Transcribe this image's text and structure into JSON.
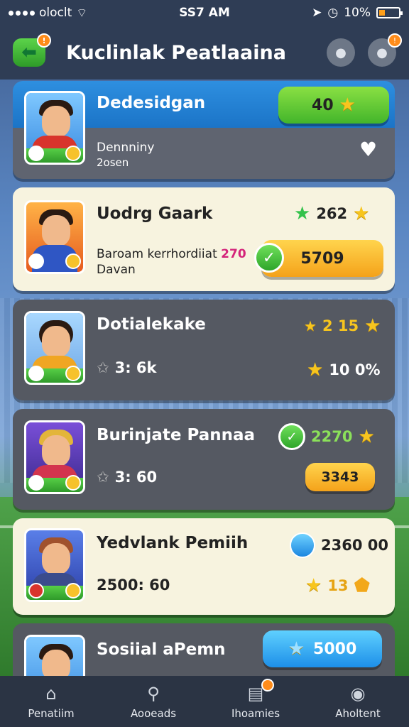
{
  "status_bar": {
    "carrier": "oloclt",
    "time": "SS7 AM",
    "battery": "10%"
  },
  "header": {
    "title": "Kuclinlak Peatlaaina"
  },
  "rows": [
    {
      "name": "Dedesidgan",
      "sub1": "Dennniny",
      "sub2": "2osen",
      "pill": "40"
    },
    {
      "name": "Uodrg Gaark",
      "score": "262",
      "sub1": "Baroam kerrhordiiat",
      "sub1_value": "270",
      "sub2": "Davan",
      "pill": "5709"
    },
    {
      "name": "Dotialekake",
      "top_stat": "2 15",
      "left_stat": "3: 6k",
      "right_stat": "10 0%"
    },
    {
      "name": "Burinjate Pannaa",
      "top_stat": "2270",
      "left_stat": "3: 60",
      "pill": "3343"
    },
    {
      "name": "Yedvlank Pemiih",
      "top_stat": "2360 00",
      "left_stat": "2500: 60",
      "right_stat": "13"
    },
    {
      "name": "Sosiial aPemn",
      "pill": "5000"
    }
  ],
  "nav": [
    {
      "label": "Penatiim",
      "icon": "home-icon"
    },
    {
      "label": "Aooeads",
      "icon": "search-icon"
    },
    {
      "label": "Ihoamies",
      "icon": "inbox-icon"
    },
    {
      "label": "Aholtent",
      "icon": "profile-icon"
    }
  ]
}
